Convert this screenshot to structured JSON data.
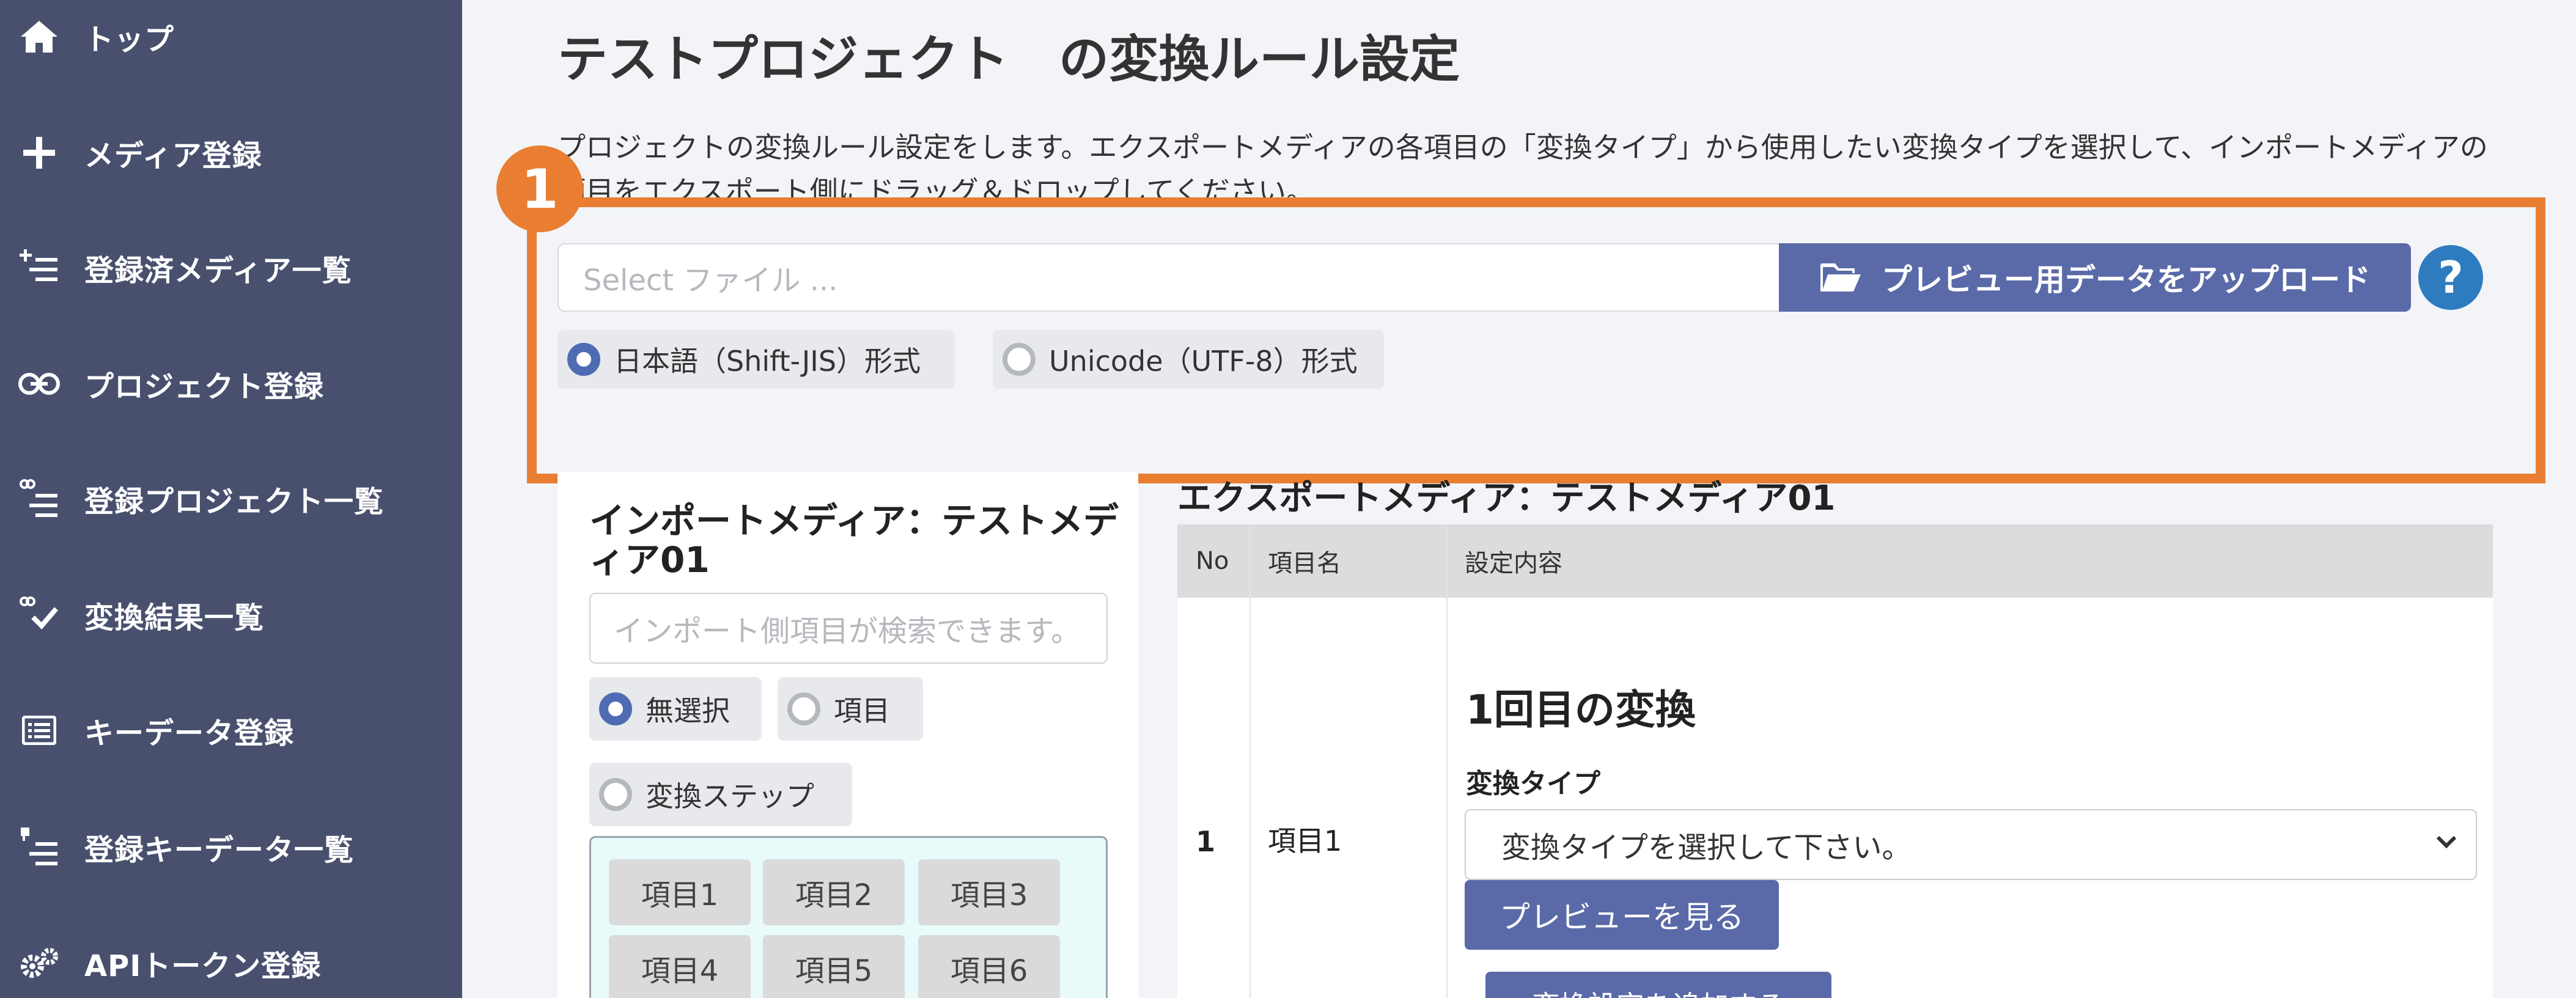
{
  "sidebar": {
    "items": [
      {
        "label": "トップ",
        "icon": "home-icon"
      },
      {
        "label": "メディア登録",
        "icon": "plus-icon"
      },
      {
        "label": "登録済メディア一覧",
        "icon": "list-add-icon"
      },
      {
        "label": "プロジェクト登録",
        "icon": "link-icon"
      },
      {
        "label": "登録プロジェクト一覧",
        "icon": "link-list-icon"
      },
      {
        "label": "変換結果一覧",
        "icon": "link-check-icon"
      },
      {
        "label": "キーデータ登録",
        "icon": "table-list-icon"
      },
      {
        "label": "登録キーデータ一覧",
        "icon": "key-list-icon"
      },
      {
        "label": "APIトークン登録",
        "icon": "gears-icon"
      }
    ]
  },
  "main": {
    "title": "テストプロジェクト　の変換ルール設定",
    "description": "プロジェクトの変換ルール設定をします。エクスポートメディアの各項目の「変換タイプ」から使用したい変換タイプを選択して、インポートメディアの項目をエクスポート側にドラッグ＆ドロップしてください。",
    "callout_number": "1",
    "file_placeholder": "Select ファイル ...",
    "upload_button": "プレビュー用データをアップロード",
    "help_symbol": "?",
    "encoding_options": [
      {
        "label": "日本語（Shift-JIS）形式",
        "checked": true
      },
      {
        "label": "Unicode（UTF-8）形式",
        "checked": false
      }
    ]
  },
  "import_panel": {
    "title": "インポートメディア：テストメディア01",
    "search_placeholder": "インポート側項目が検索できます。",
    "filter_options": [
      {
        "label": "無選択",
        "checked": true
      },
      {
        "label": "項目",
        "checked": false
      },
      {
        "label": "変換ステップ",
        "checked": false
      }
    ],
    "items": [
      "項目1",
      "項目2",
      "項目3",
      "項目4",
      "項目5",
      "項目6"
    ]
  },
  "export_panel": {
    "title": "エクスポートメディア：テストメディア01",
    "columns": [
      "No",
      "項目名",
      "設定内容"
    ],
    "rows": [
      {
        "no": "1",
        "name": "項目1",
        "conversion_heading": "1回目の変換",
        "type_label": "変換タイプ",
        "type_select": "変換タイプを選択して下さい。",
        "preview_button": "プレビューを見る",
        "add_button": "変換設定を追加する"
      }
    ]
  },
  "colors": {
    "sidebar_bg": "#48506e",
    "accent": "#5a6aa8",
    "callout": "#e97e32",
    "help": "#2f7bbf"
  }
}
